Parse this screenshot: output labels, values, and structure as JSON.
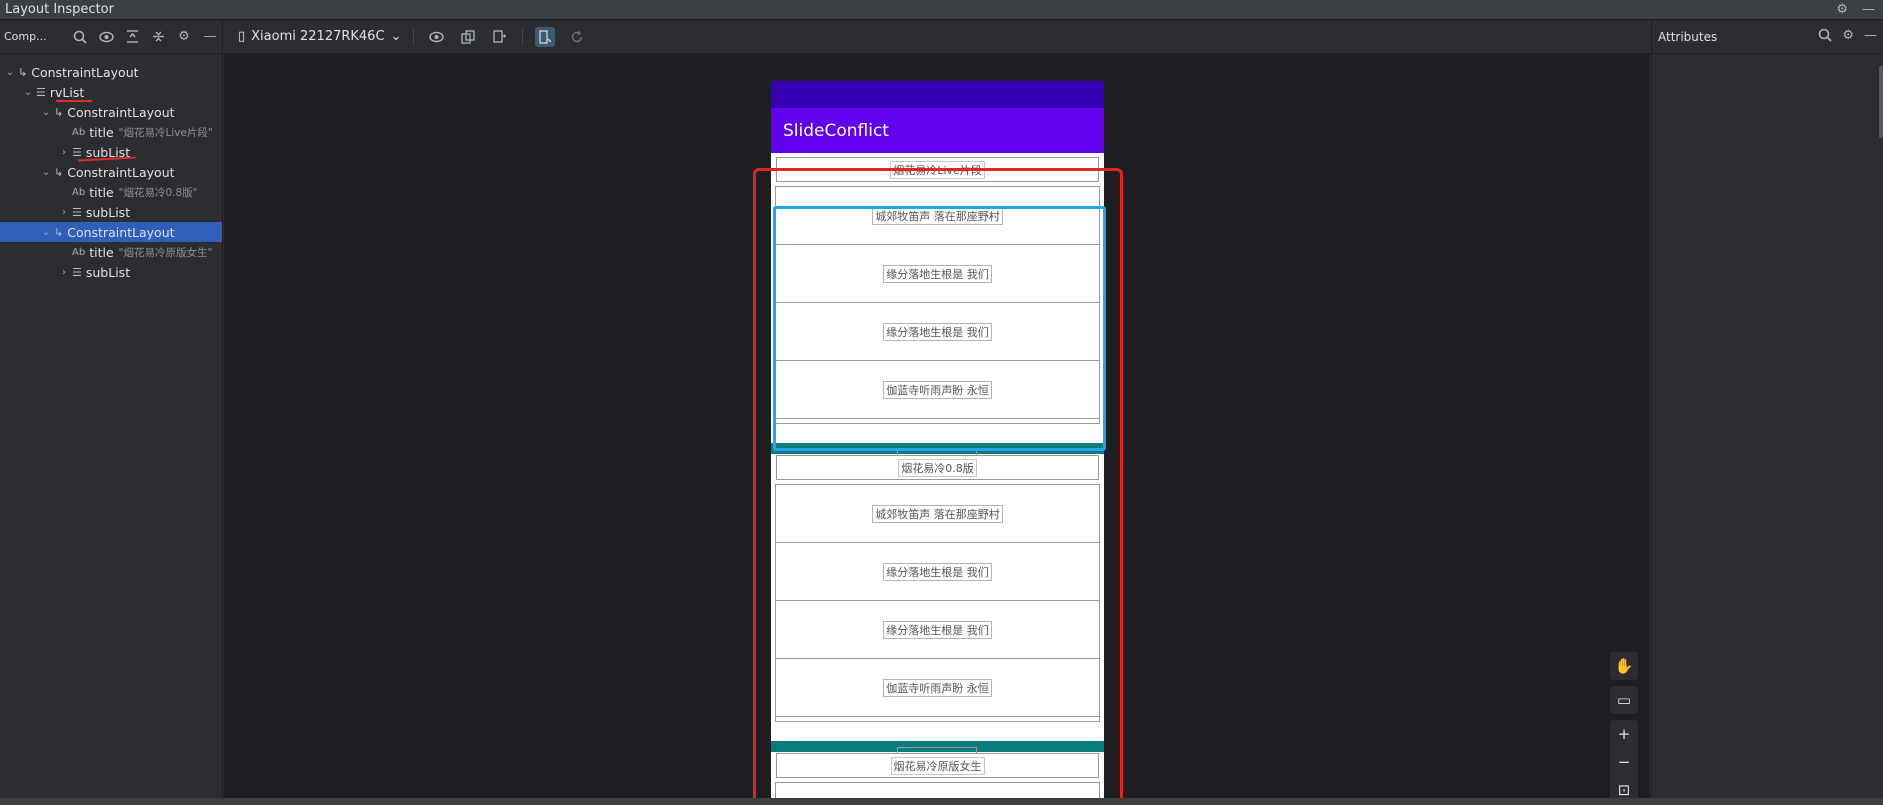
{
  "window": {
    "title": "Layout Inspector"
  },
  "component_tree": {
    "label": "Comp...",
    "nodes": [
      {
        "text": "ConstraintLayout",
        "hint": ""
      },
      {
        "text": "rvList",
        "hint": ""
      },
      {
        "text": "ConstraintLayout",
        "hint": ""
      },
      {
        "text": "title",
        "hint": "\"烟花易冷Live片段\""
      },
      {
        "text": "subList",
        "hint": ""
      },
      {
        "text": "ConstraintLayout",
        "hint": ""
      },
      {
        "text": "title",
        "hint": "\"烟花易冷0.8版\""
      },
      {
        "text": "subList",
        "hint": ""
      },
      {
        "text": "ConstraintLayout",
        "hint": ""
      },
      {
        "text": "title",
        "hint": "\"烟花易冷原版女生\""
      },
      {
        "text": "subList",
        "hint": ""
      }
    ]
  },
  "device": {
    "name": "Xiaomi 22127RK46C"
  },
  "app": {
    "title": "SlideConflict",
    "colors": {
      "status": "#3700b3",
      "appbar": "#6200ee",
      "divider": "#0b7b7b"
    },
    "sections": [
      {
        "title": "烟花易冷Live片段",
        "items": [
          "城郊牧笛声 落在那座野村",
          "缘分落地生根是 我们",
          "缘分落地生根是 我们",
          "伽蓝寺听雨声盼 永恒"
        ]
      },
      {
        "title": "烟花易冷0.8版",
        "items": [
          "城郊牧笛声 落在那座野村",
          "缘分落地生根是 我们",
          "缘分落地生根是 我们",
          "伽蓝寺听雨声盼 永恒"
        ]
      },
      {
        "title": "烟花易冷原版女生",
        "items": []
      }
    ]
  },
  "attributes": {
    "label": "Attributes"
  },
  "icons": {
    "search": "search-icon",
    "eye": "eye-icon",
    "expand": "expand-all-icon",
    "collapse": "collapse-all-icon",
    "settings": "gear-icon",
    "minimize": "minimize-icon",
    "phone": "phone-icon",
    "hand": "hand-icon",
    "zoom_in": "zoom-in-icon",
    "zoom_out": "zoom-out-icon",
    "fit": "fit-screen-icon"
  },
  "annotation_colors": {
    "red": "#e3261d",
    "blue": "#22a7e8"
  }
}
